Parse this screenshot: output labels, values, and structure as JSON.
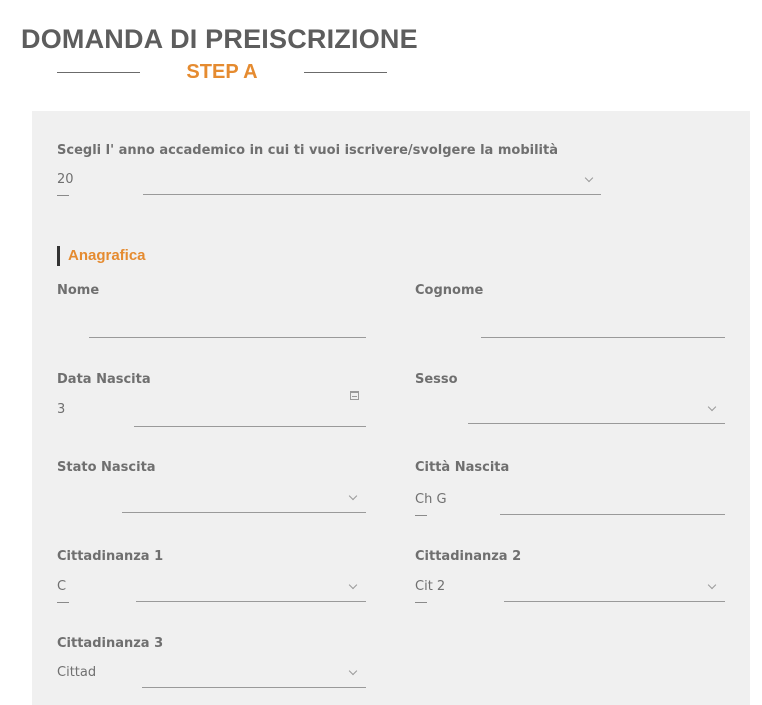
{
  "header": {
    "title": "DOMANDA DI PREISCRIZIONE",
    "step": "STEP A"
  },
  "academic_year": {
    "label": "Scegli l'   anno accademico in cui ti vuoi iscrivere/svolgere la mobilità",
    "value": "20"
  },
  "section": {
    "title": "Anagrafica"
  },
  "fields": {
    "nome": {
      "label": "Nome",
      "value": ""
    },
    "cognome": {
      "label": "Cognome",
      "value": ""
    },
    "data_nascita": {
      "label": "Data Nascita",
      "value": "3"
    },
    "sesso": {
      "label": "Sesso",
      "value": ""
    },
    "stato_nascita": {
      "label": "Stato Nascita",
      "value": ""
    },
    "citta_nascita": {
      "label": "Città Nascita",
      "value": "Ch            G"
    },
    "cittadinanza1": {
      "label": "Cittadinanza 1",
      "value": "C"
    },
    "cittadinanza2": {
      "label": "Cittadinanza 2",
      "value": "Cit              2"
    },
    "cittadinanza3": {
      "label": "Cittadinanza 3",
      "value": "Cittad"
    }
  },
  "icons": {
    "dropdown": "chevron-down-icon",
    "date": "calendar-icon"
  },
  "colors": {
    "accent": "#e58b30",
    "panel_bg": "#f0f0f0",
    "title": "#5d5d5d"
  }
}
